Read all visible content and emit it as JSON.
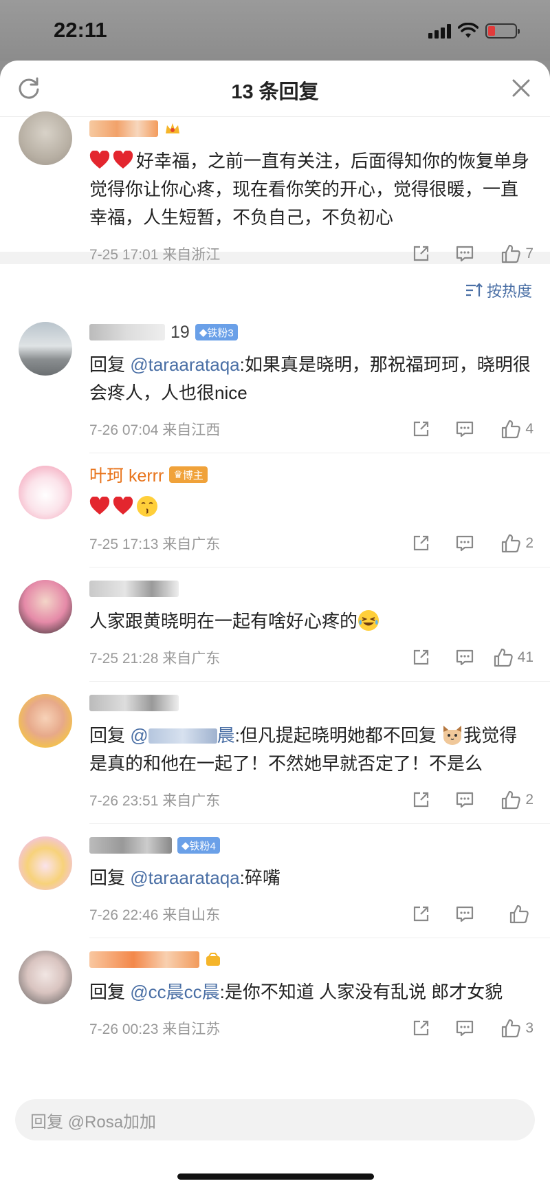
{
  "status_bar": {
    "time": "22:11"
  },
  "header": {
    "title": "13 条回复"
  },
  "top_comment": {
    "text": "好幸福，之前一直有关注，后面得知你的恢复单身觉得你让你心疼，现在看你笑的开心，觉得很暖，一直幸福，人生短暂，不负自己，不负初心",
    "time": "7-25 17:01 来自浙江",
    "likes": "7"
  },
  "sort": {
    "label": "按热度"
  },
  "replies": [
    {
      "name_visible": "19",
      "badge": "铁粉3",
      "prefix": "回复 ",
      "mention": "@taraarataqa",
      "text": ":如果真是晓明，那祝福珂珂，晓明很会疼人，人也很nice",
      "time": "7-26 07:04 来自江西",
      "likes": "4"
    },
    {
      "name_visible": "叶珂 kerrr",
      "badge": "博主",
      "prefix": "",
      "mention": "",
      "text": "",
      "time": "7-25 17:13 来自广东",
      "likes": "2"
    },
    {
      "name_visible": "",
      "badge": "",
      "prefix": "",
      "mention": "",
      "text": "人家跟黄晓明在一起有啥好心疼的",
      "time": "7-25 21:28 来自广东",
      "likes": "41"
    },
    {
      "name_visible": "",
      "badge": "",
      "prefix": "回复 ",
      "mention": "@",
      "mention_tail": "晨",
      "text_a": ":但凡提起晓明她都不回复",
      "text_b": "我觉得是真的和他在一起了！不然她早就否定了！不是么",
      "time": "7-26 23:51 来自广东",
      "likes": "2"
    },
    {
      "name_visible": "",
      "badge": "铁粉4",
      "prefix": "回复 ",
      "mention": "@taraarataqa",
      "text": ":碎嘴",
      "time": "7-26 22:46 来自山东",
      "likes": ""
    },
    {
      "name_visible": "",
      "badge": "",
      "prefix": "回复 ",
      "mention": "@cc晨cc晨",
      "text": ":是你不知道 人家没有乱说 郎才女貌",
      "time": "7-26 00:23 来自江苏",
      "likes": "3"
    }
  ],
  "reply_bar": {
    "placeholder": "回复 @Rosa加加"
  },
  "colors": {
    "mention": "#4a6fa5",
    "blogger_name": "#e8741c",
    "badge_fan": "#6aa0e8",
    "badge_blogger": "#f0a23a"
  }
}
